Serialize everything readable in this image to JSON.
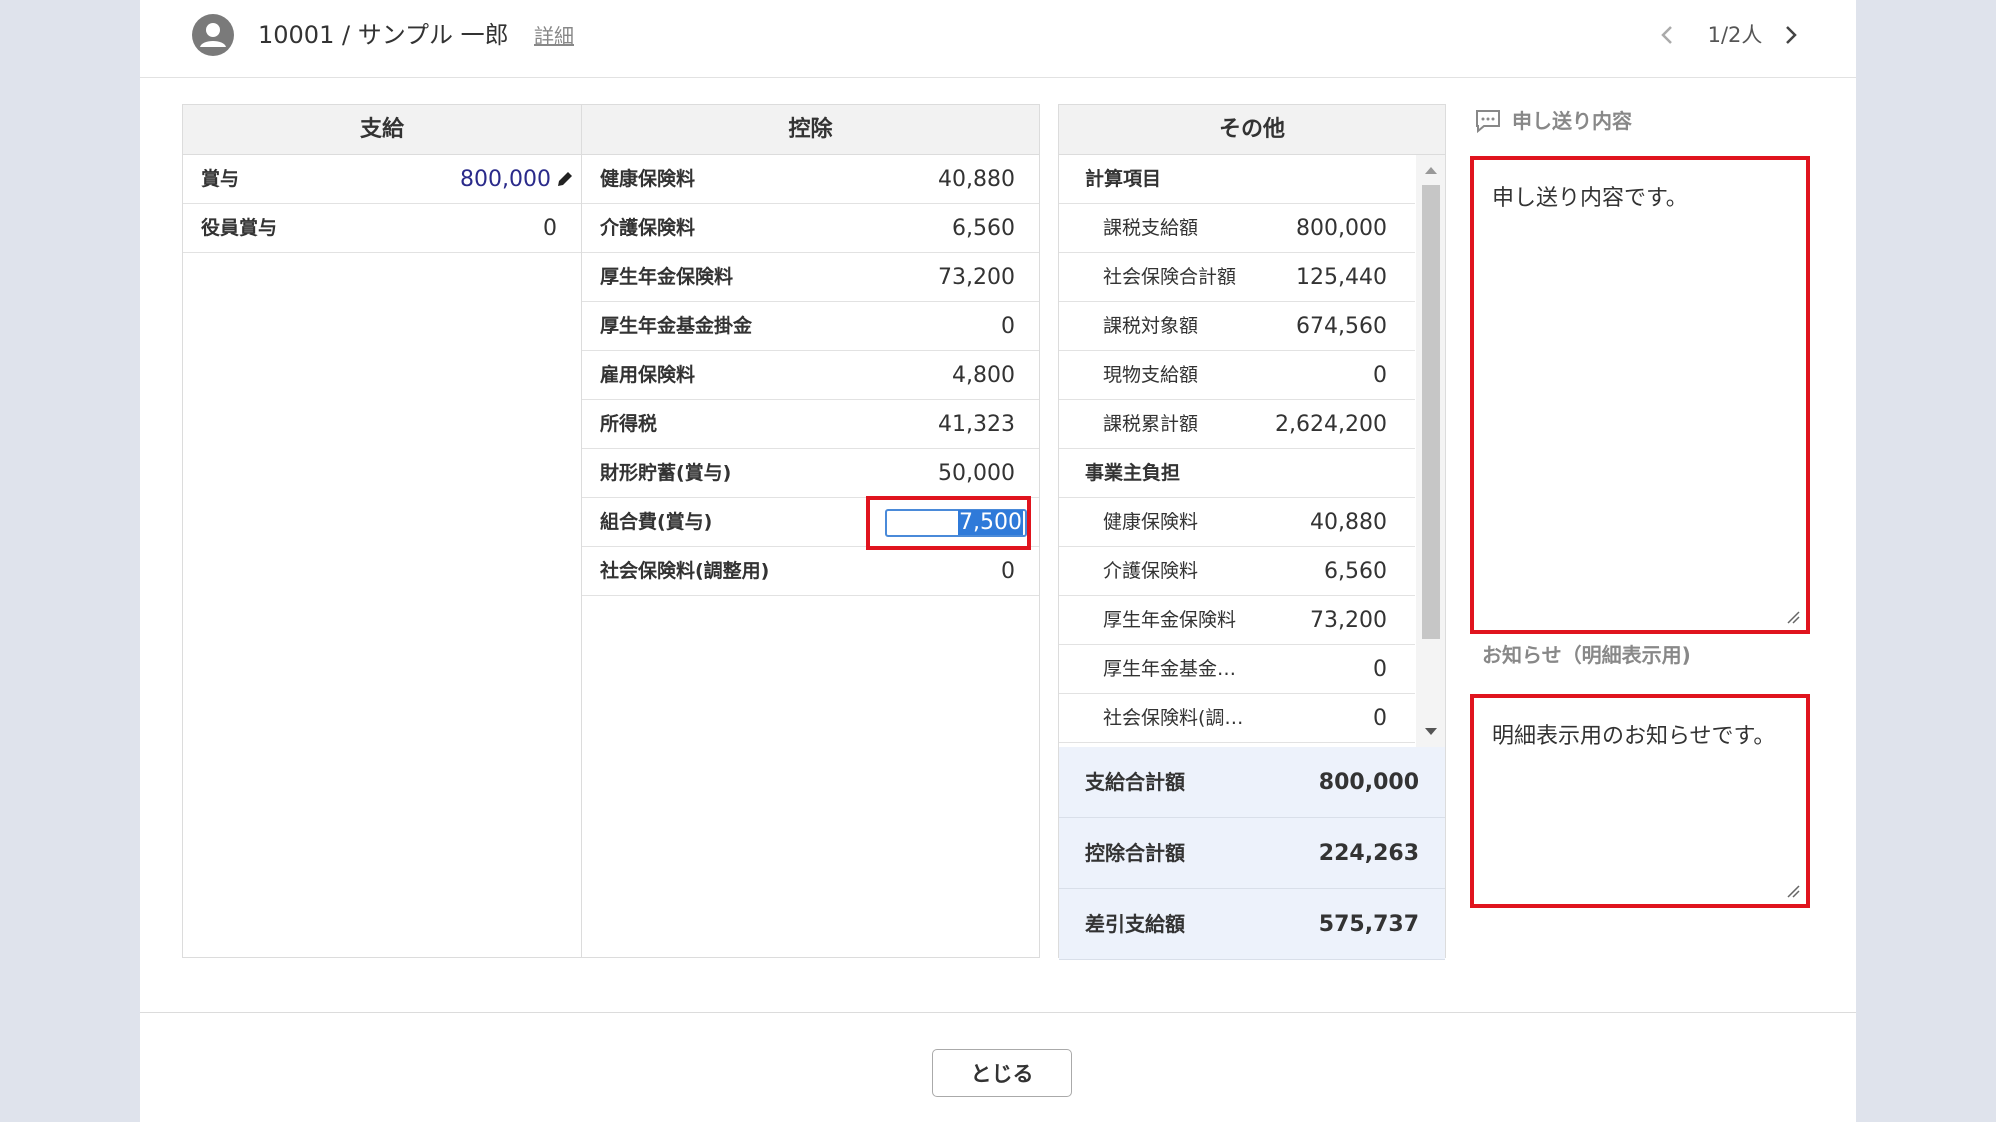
{
  "header": {
    "employee": "10001 / サンプル 一郎",
    "detail_link": "詳細",
    "pager": "1/2人"
  },
  "payments": {
    "title": "支給",
    "rows": [
      {
        "label": "賞与",
        "value": "800,000"
      },
      {
        "label": "役員賞与",
        "value": "0"
      }
    ]
  },
  "deductions": {
    "title": "控除",
    "rows": [
      {
        "label": "健康保険料",
        "value": "40,880"
      },
      {
        "label": "介護保険料",
        "value": "6,560"
      },
      {
        "label": "厚生年金保険料",
        "value": "73,200"
      },
      {
        "label": "厚生年金基金掛金",
        "value": "0"
      },
      {
        "label": "雇用保険料",
        "value": "4,800"
      },
      {
        "label": "所得税",
        "value": "41,323"
      },
      {
        "label": "財形貯蓄(賞与)",
        "value": "50,000"
      },
      {
        "label": "組合費(賞与)",
        "value": "7,500"
      },
      {
        "label": "社会保険料(調整用)",
        "value": "0"
      }
    ]
  },
  "other": {
    "title": "その他",
    "rows": [
      {
        "label": "計算項目",
        "value": ""
      },
      {
        "label": "課税支給額",
        "value": "800,000"
      },
      {
        "label": "社会保険合計額",
        "value": "125,440"
      },
      {
        "label": "課税対象額",
        "value": "674,560"
      },
      {
        "label": "現物支給額",
        "value": "0"
      },
      {
        "label": "課税累計額",
        "value": "2,624,200"
      },
      {
        "label": "事業主負担",
        "value": ""
      },
      {
        "label": "健康保険料",
        "value": "40,880"
      },
      {
        "label": "介護保険料",
        "value": "6,560"
      },
      {
        "label": "厚生年金保険料",
        "value": "73,200"
      },
      {
        "label": "厚生年金基金…",
        "value": "0"
      },
      {
        "label": "社会保険料(調…",
        "value": "0"
      }
    ],
    "totals": [
      {
        "label": "支給合計額",
        "value": "800,000"
      },
      {
        "label": "控除合計額",
        "value": "224,263"
      },
      {
        "label": "差引支給額",
        "value": "575,737"
      }
    ]
  },
  "notes": {
    "memo_title": "申し送り内容",
    "memo_text": "申し送り内容です。",
    "notice_label": "お知らせ（明細表示用)",
    "notice_text": "明細表示用のお知らせです。"
  },
  "footer": {
    "close_label": "とじる"
  },
  "colors": {
    "highlight": "#e0141e",
    "total_bg": "#edf2fb",
    "selection": "#2f7ad9"
  }
}
